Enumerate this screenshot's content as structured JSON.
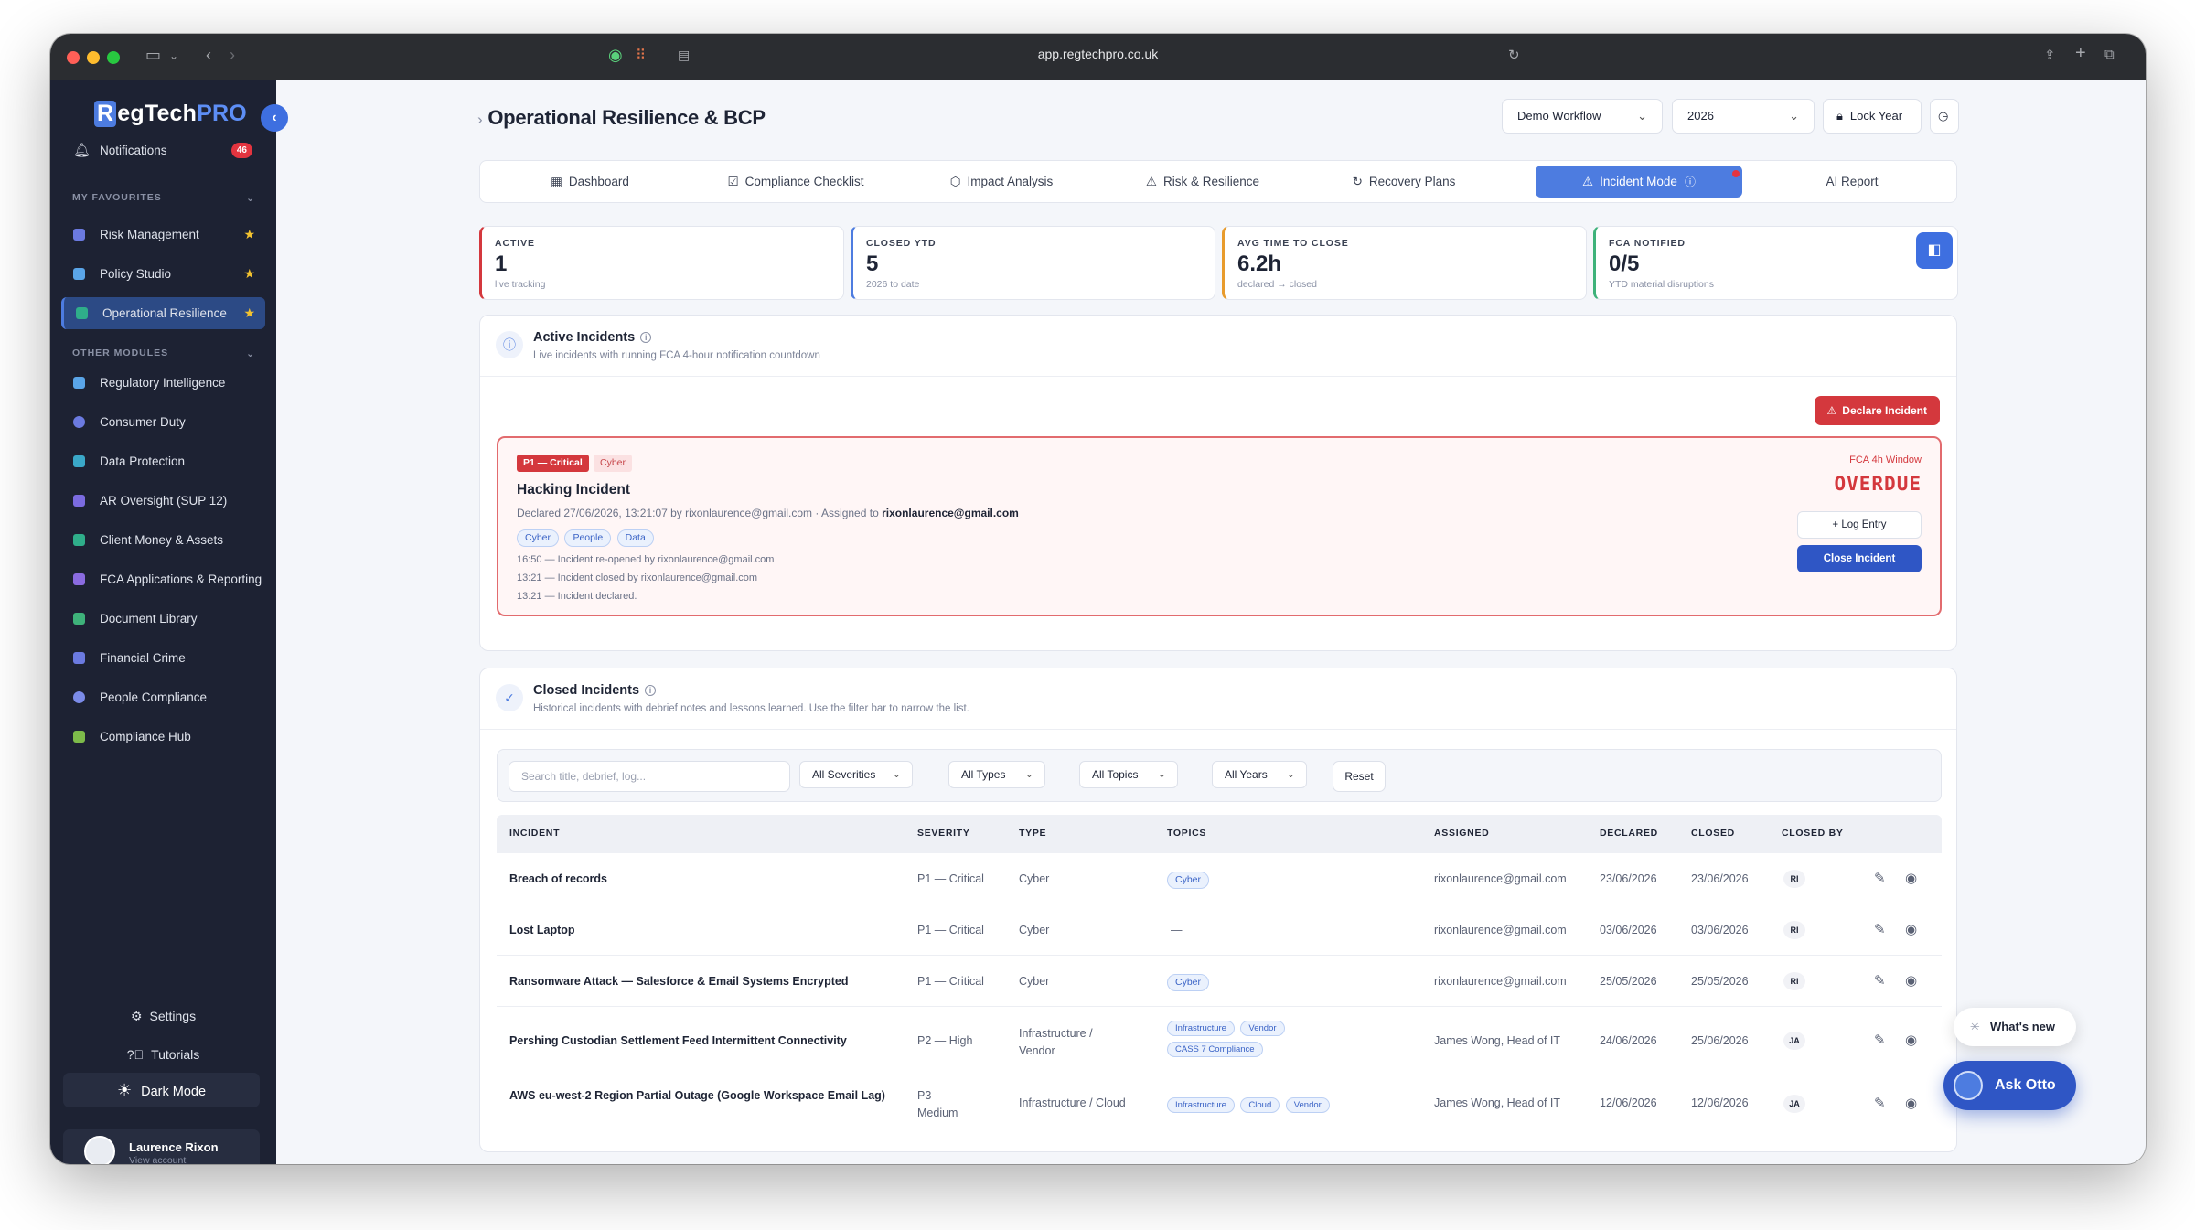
{
  "browser": {
    "url": "app.regtechpro.co.uk"
  },
  "brand": {
    "logo_r": "R",
    "logo_mid": "egTech",
    "logo_pro": "PRO",
    "accent": "#4d7ce0",
    "danger": "#d4383d"
  },
  "sidebar": {
    "notifications": {
      "label": "Notifications",
      "count": "46"
    },
    "favourites_heading": "MY FAVOURITES",
    "favourites": [
      {
        "label": "Risk Management",
        "icon": "shield-icon"
      },
      {
        "label": "Policy Studio",
        "icon": "document-icon"
      },
      {
        "label": "Operational Resilience",
        "icon": "shield-icon"
      }
    ],
    "other_heading": "OTHER MODULES",
    "modules": [
      {
        "label": "Regulatory Intelligence"
      },
      {
        "label": "Consumer Duty"
      },
      {
        "label": "Data Protection"
      },
      {
        "label": "AR Oversight (SUP 12)"
      },
      {
        "label": "Client Money & Assets"
      },
      {
        "label": "FCA Applications & Reporting"
      },
      {
        "label": "Document Library"
      },
      {
        "label": "Financial Crime"
      },
      {
        "label": "People Compliance"
      },
      {
        "label": "Compliance Hub"
      }
    ],
    "settings": "Settings",
    "tutorials": "Tutorials",
    "dark_mode": "Dark Mode",
    "user": {
      "name": "Laurence Rixon",
      "sub": "View account"
    }
  },
  "header": {
    "title": "Operational Resilience & BCP",
    "workflow": "Demo Workflow",
    "year": "2026",
    "lock": "Lock Year"
  },
  "tabs": [
    {
      "label": "Dashboard",
      "icon": "grid-icon"
    },
    {
      "label": "Compliance Checklist",
      "icon": "checklist-icon"
    },
    {
      "label": "Impact Analysis",
      "icon": "hexagon-icon"
    },
    {
      "label": "Risk & Resilience",
      "icon": "warning-icon"
    },
    {
      "label": "Recovery Plans",
      "icon": "refresh-icon"
    },
    {
      "label": "Incident Mode",
      "icon": "warning-icon"
    },
    {
      "label": "AI Report"
    }
  ],
  "kpis": [
    {
      "label": "ACTIVE",
      "value": "1",
      "sub": "live tracking",
      "color": "#d4383d"
    },
    {
      "label": "CLOSED YTD",
      "value": "5",
      "sub": "2026 to date",
      "color": "#4d7ce0"
    },
    {
      "label": "AVG TIME TO CLOSE",
      "value": "6.2h",
      "sub": "declared → closed",
      "color": "#e89b2c"
    },
    {
      "label": "FCA NOTIFIED",
      "value": "0/5",
      "sub": "YTD material disruptions",
      "color": "#3eb27a"
    }
  ],
  "active": {
    "title": "Active Incidents",
    "sub": "Live incidents with running FCA 4-hour notification countdown",
    "declare_btn": "Declare Incident",
    "incident": {
      "severity": "P1 — Critical",
      "type": "Cyber",
      "title": "Hacking Incident",
      "meta": "Declared 27/06/2026, 13:21:07 by rixonlaurence@gmail.com · Assigned to",
      "assignee": "rixonlaurence@gmail.com",
      "tags": [
        "Cyber",
        "People",
        "Data"
      ],
      "log": [
        "16:50 — Incident re-opened by rixonlaurence@gmail.com",
        "13:21 — Incident closed by rixonlaurence@gmail.com",
        "13:21 — Incident declared."
      ],
      "window_label": "FCA 4h Window",
      "status": "OVERDUE",
      "log_btn": "+ Log Entry",
      "close_btn": "Close Incident"
    }
  },
  "closed": {
    "title": "Closed Incidents",
    "sub": "Historical incidents with debrief notes and lessons learned. Use the filter bar to narrow the list.",
    "search_placeholder": "Search title, debrief, log...",
    "filters": [
      "All Severities",
      "All Types",
      "All Topics",
      "All Years"
    ],
    "reset": "Reset",
    "columns": [
      "INCIDENT",
      "SEVERITY",
      "TYPE",
      "TOPICS",
      "ASSIGNED",
      "DECLARED",
      "CLOSED",
      "CLOSED BY"
    ],
    "rows": [
      {
        "incident": "Breach of records",
        "severity": "P1 — Critical",
        "type": "Cyber",
        "topics": [
          "Cyber"
        ],
        "assigned": "rixonlaurence@gmail.com",
        "declared": "23/06/2026",
        "closed": "23/06/2026",
        "by": "RI"
      },
      {
        "incident": "Lost Laptop",
        "severity": "P1 — Critical",
        "type": "Cyber",
        "topics": [],
        "topics_empty": "—",
        "assigned": "rixonlaurence@gmail.com",
        "declared": "03/06/2026",
        "closed": "03/06/2026",
        "by": "RI"
      },
      {
        "incident": "Ransomware Attack — Salesforce & Email Systems Encrypted",
        "severity": "P1 — Critical",
        "type": "Cyber",
        "topics": [
          "Cyber"
        ],
        "assigned": "rixonlaurence@gmail.com",
        "declared": "25/05/2026",
        "closed": "25/05/2026",
        "by": "RI"
      },
      {
        "incident": "Pershing Custodian Settlement Feed Intermittent Connectivity",
        "severity": "P2 — High",
        "type": "Infrastructure / Vendor",
        "topics": [
          "Infrastructure",
          "Vendor",
          "CASS 7 Compliance"
        ],
        "assigned": "James Wong, Head of IT",
        "declared": "24/06/2026",
        "closed": "25/06/2026",
        "by": "JA"
      },
      {
        "incident": "AWS eu-west-2 Region Partial Outage (Google Workspace Email Lag)",
        "severity": "P3 — Medium",
        "type": "Infrastructure / Cloud",
        "topics": [
          "Infrastructure",
          "Cloud",
          "Vendor"
        ],
        "assigned": "James Wong, Head of IT",
        "declared": "12/06/2026",
        "closed": "12/06/2026",
        "by": "JA"
      }
    ]
  },
  "floating": {
    "whats_new": "What's new",
    "ask": "Ask Otto"
  }
}
